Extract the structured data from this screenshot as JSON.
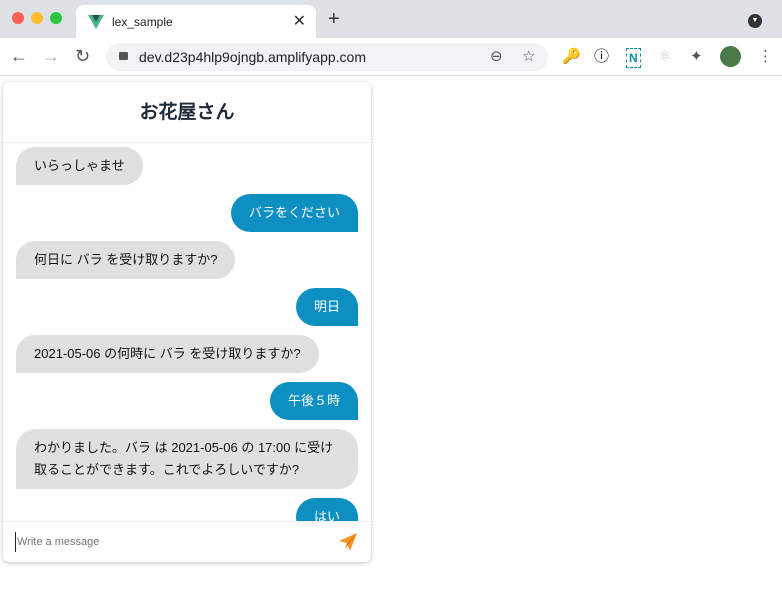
{
  "browser": {
    "tab_title": "lex_sample",
    "url": "dev.d23p4hlp9ojngb.amplifyapp.com"
  },
  "chat": {
    "title": "お花屋さん",
    "messages": [
      {
        "from": "bot",
        "text": "いらっしゃませ"
      },
      {
        "from": "user",
        "text": "バラをください"
      },
      {
        "from": "bot",
        "text": "何日に バラ を受け取りますか?"
      },
      {
        "from": "user",
        "text": "明日"
      },
      {
        "from": "bot",
        "text": "2021-05-06 の何時に バラ を受け取りますか?"
      },
      {
        "from": "user",
        "text": "午後５時"
      },
      {
        "from": "bot",
        "text": "わかりました。バラ は 2021-05-06 の 17:00 に受け取ることができます。これでよろしいですか?"
      },
      {
        "from": "user",
        "text": "はい"
      }
    ],
    "input_placeholder": "Write a message",
    "accent": "#0d8fc2",
    "send_color": "#f7931e"
  }
}
